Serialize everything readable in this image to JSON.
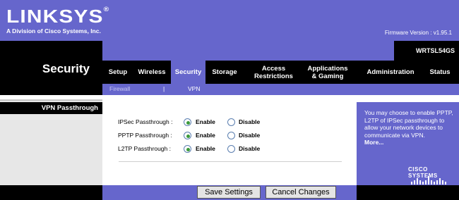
{
  "header": {
    "logo_text": "LINKSYS",
    "logo_mark": "®",
    "tagline": "A Division of Cisco Systems, Inc.",
    "firmware": "Firmware Version : v1.95.1"
  },
  "model": "WRTSL54GS",
  "section_title": "Security",
  "nav": {
    "items": [
      {
        "label": "Setup"
      },
      {
        "label": "Wireless"
      },
      {
        "label": "Security"
      },
      {
        "label": "Storage"
      },
      {
        "label": "Access\nRestrictions"
      },
      {
        "label": "Applications\n& Gaming"
      },
      {
        "label": "Administration"
      },
      {
        "label": "Status"
      }
    ],
    "active": "Security"
  },
  "subnav": {
    "items": [
      {
        "label": "Firewall"
      },
      {
        "label": "VPN"
      }
    ],
    "separator": "|",
    "active": "VPN"
  },
  "left_heading": "VPN Passthrough",
  "passthrough": {
    "rows": [
      {
        "label": "IPSec Passthrough :",
        "enable": "Enable",
        "disable": "Disable",
        "selected": "Enable"
      },
      {
        "label": "PPTP Passthrough :",
        "enable": "Enable",
        "disable": "Disable",
        "selected": "Enable"
      },
      {
        "label": "L2TP Passthrough :",
        "enable": "Enable",
        "disable": "Disable",
        "selected": "Enable"
      }
    ]
  },
  "help": {
    "text": "You may choose to enable PPTP, L2TP of IPSec passthrough to allow your network devices to communicate via VPN.",
    "more": "More..."
  },
  "cisco_brand": "CISCO SYSTEMS",
  "buttons": {
    "save": "Save Settings",
    "cancel": "Cancel Changes"
  },
  "colors": {
    "brand_purple": "#6666cc",
    "black": "#000000",
    "radio_selected": "#3a9a3a"
  }
}
